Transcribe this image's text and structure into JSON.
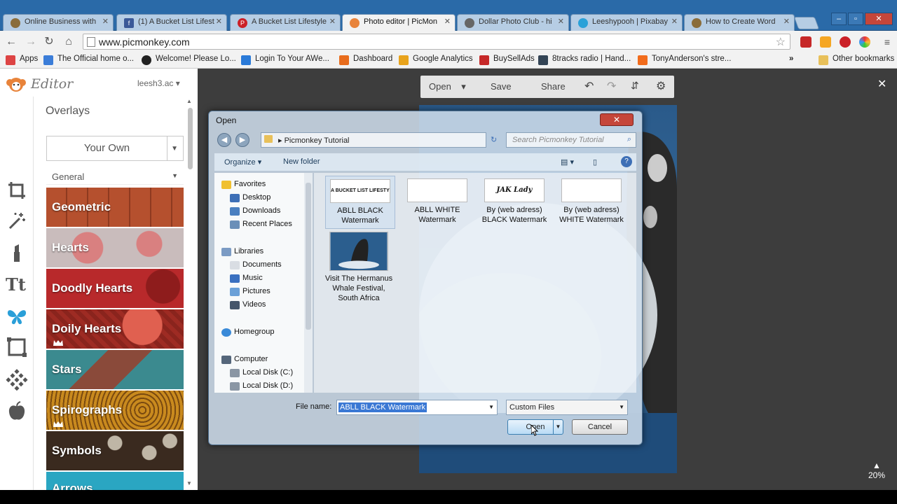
{
  "browser": {
    "tabs": [
      {
        "label": "Online Business with",
        "fav_color": "#8a6d3b",
        "active": false
      },
      {
        "label": "(1) A Bucket List Lifest",
        "fav_color": "#3b5998",
        "active": false
      },
      {
        "label": "A Bucket List Lifestyle",
        "fav_color": "#cb2027",
        "active": false
      },
      {
        "label": "Photo editor | PicMon",
        "fav_color": "#e8833a",
        "active": true
      },
      {
        "label": "Dollar Photo Club - hi",
        "fav_color": "#666666",
        "active": false
      },
      {
        "label": "Leeshypooh | Pixabay",
        "fav_color": "#2aa1d8",
        "active": false
      },
      {
        "label": "How to Create Word",
        "fav_color": "#8a6d3b",
        "active": false
      }
    ],
    "url": "www.picmonkey.com",
    "bookmarks": [
      {
        "label": "Apps",
        "color": "#d44"
      },
      {
        "label": "The Official home o...",
        "color": "#3b7dd8"
      },
      {
        "label": "Welcome! Please Lo...",
        "color": "#222"
      },
      {
        "label": "Login To Your AWe...",
        "color": "#2a7ad8"
      },
      {
        "label": "Dashboard",
        "color": "#e86c1c"
      },
      {
        "label": "Google Analytics",
        "color": "#e8a31c"
      },
      {
        "label": "BuySellAds",
        "color": "#c62828"
      },
      {
        "label": "8tracks radio | Hand...",
        "color": "#334455"
      },
      {
        "label": "TonyAnderson's stre...",
        "color": "#f26c1c"
      }
    ],
    "bookmarks_overflow": "»",
    "other_bookmarks": "Other bookmarks"
  },
  "editor": {
    "brand": "Editor",
    "user": "leesh3.ac",
    "panel_title": "Overlays",
    "your_own": "Your Own",
    "category_select": "General",
    "categories": [
      {
        "label": "Geometric",
        "color": "#b5502e",
        "crown": false
      },
      {
        "label": "Hearts",
        "color": "#c9a6a4",
        "crown": false
      },
      {
        "label": "Doodly Hearts",
        "color": "#b8292b",
        "crown": false
      },
      {
        "label": "Doily Hearts",
        "color": "#9e2b23",
        "crown": true
      },
      {
        "label": "Stars",
        "color": "#3b8a8f",
        "crown": false
      },
      {
        "label": "Spirographs",
        "color": "#c98a1e",
        "crown": true
      },
      {
        "label": "Symbols",
        "color": "#3a2a1f",
        "crown": false
      },
      {
        "label": "Arrows",
        "color": "#2aa6c2",
        "crown": false
      }
    ],
    "topbar": {
      "open": "Open",
      "save": "Save",
      "share": "Share"
    },
    "zoom": "20%"
  },
  "dialog": {
    "title": "Open",
    "path": "Picmonkey Tutorial",
    "search_placeholder": "Search Picmonkey Tutorial",
    "organize": "Organize",
    "new_folder": "New folder",
    "nav": {
      "favorites": "Favorites",
      "desktop": "Desktop",
      "downloads": "Downloads",
      "recent": "Recent Places",
      "libraries": "Libraries",
      "documents": "Documents",
      "music": "Music",
      "pictures": "Pictures",
      "videos": "Videos",
      "homegroup": "Homegroup",
      "computer": "Computer",
      "local_c": "Local Disk (C:)",
      "local_d": "Local Disk (D:)"
    },
    "files": [
      {
        "name": "ABLL BLACK Watermark",
        "thumb_text": "A BUCKET LIST LIFESTYLE"
      },
      {
        "name": "ABLL WHITE Watermark",
        "thumb_text": ""
      },
      {
        "name": "By (web adress) BLACK Watermark",
        "thumb_text": "JAK Lady"
      },
      {
        "name": "By (web adress) WHITE Watermark",
        "thumb_text": ""
      },
      {
        "name": "Visit The Hermanus Whale Festival, South Africa",
        "thumb_text": ""
      }
    ],
    "filename_label": "File name:",
    "filename_value": "ABLL BLACK Watermark",
    "filetype": "Custom Files",
    "open_btn": "Open",
    "cancel_btn": "Cancel"
  },
  "photo_watermark": "Visit the Hermanus Whale Festival, South Africa"
}
